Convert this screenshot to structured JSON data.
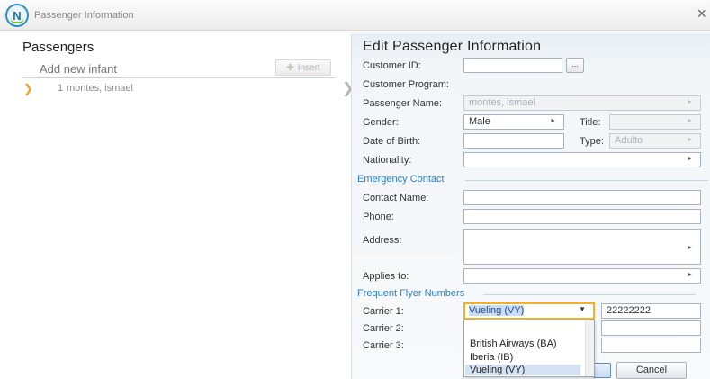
{
  "window": {
    "title": "Passenger Information",
    "close_glyph": "×",
    "logo_letter": "N"
  },
  "passengers": {
    "title": "Passengers",
    "add_placeholder": "Add new infant",
    "insert_label": "Insert",
    "list": [
      {
        "number": "1",
        "name": "montes, ismael"
      }
    ]
  },
  "edit": {
    "title": "Edit Passenger Information",
    "labels": {
      "customer_id": "Customer ID:",
      "customer_program": "Customer Program:",
      "passenger_name": "Passenger Name:",
      "gender": "Gender:",
      "title": "Title:",
      "date_of_birth": "Date of Birth:",
      "type": "Type:",
      "nationality": "Nationality:",
      "contact_name": "Contact Name:",
      "phone": "Phone:",
      "address": "Address:",
      "applies_to": "Applies to:",
      "carrier_1": "Carrier 1:",
      "carrier_2": "Carrier 2:",
      "carrier_3": "Carrier 3:"
    },
    "values": {
      "customer_id": "",
      "passenger_name": "montes, ismael",
      "gender": "Male",
      "title": "",
      "date_of_birth": "",
      "type": "Adulto",
      "nationality": "",
      "contact_name": "",
      "phone": "",
      "address": "",
      "applies_to": "",
      "carrier_1": "Vueling (VY)",
      "carrier_1_number": "22222222",
      "carrier_2_number": "",
      "carrier_3_number": ""
    },
    "dots_label": "...",
    "sections": {
      "emergency": "Emergency Contact",
      "frequent_flyer": "Frequent Flyer Numbers"
    },
    "carrier_options": [
      "British Airways (BA)",
      "Iberia (IB)",
      "Vueling (VY)"
    ],
    "cancel_label": "Cancel"
  },
  "colors": {
    "section_heading": "#2b7cc6",
    "focus_border": "#f0b128",
    "selection_arrow": "#f3a02a"
  }
}
